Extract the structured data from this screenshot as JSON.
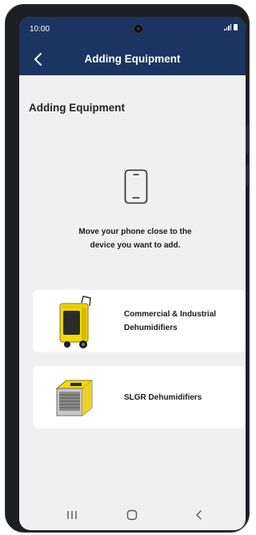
{
  "status_bar": {
    "time": "10:00"
  },
  "header": {
    "title": "Adding Equipment"
  },
  "main": {
    "page_title": "Adding Equipment",
    "instruction_line1": "Move your phone close to the",
    "instruction_line2": "device you want to add.",
    "equipment": [
      {
        "label_line1": "Commercial & Industrial",
        "label_line2": "Dehumidifiers",
        "icon": "industrial-dehumidifier-image"
      },
      {
        "label": "SLGR Dehumidifiers",
        "icon": "slgr-dehumidifier-image"
      }
    ]
  },
  "colors": {
    "header": "#1b3461",
    "background": "#f0f0f0",
    "card": "#ffffff",
    "product_yellow": "#f2d90c"
  }
}
